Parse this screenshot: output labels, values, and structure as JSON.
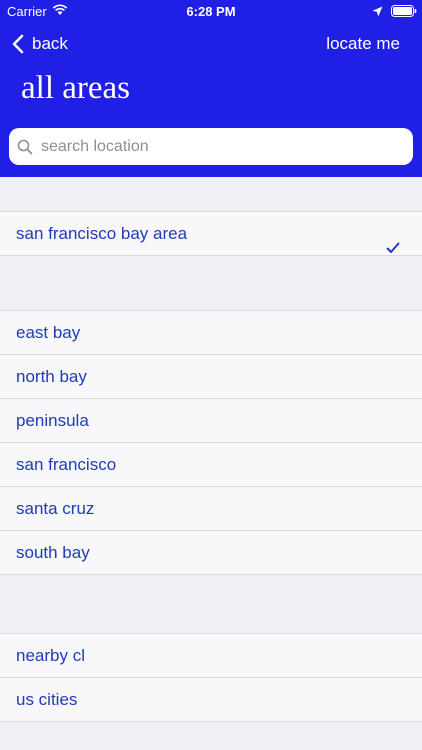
{
  "status_bar": {
    "carrier": "Carrier",
    "time": "6:28 PM",
    "icons": [
      "wifi-icon",
      "location-arrow-icon",
      "battery-icon"
    ]
  },
  "nav": {
    "back_label": "back",
    "locate_label": "locate me"
  },
  "title": "all areas",
  "search": {
    "placeholder": "search location"
  },
  "sections": [
    {
      "items": [
        {
          "label": "san francisco bay area",
          "selected": true
        }
      ]
    },
    {
      "items": [
        {
          "label": "east bay"
        },
        {
          "label": "north bay"
        },
        {
          "label": "peninsula"
        },
        {
          "label": "san francisco"
        },
        {
          "label": "santa cruz"
        },
        {
          "label": "south bay"
        }
      ]
    },
    {
      "items": [
        {
          "label": "nearby cl"
        },
        {
          "label": "us cities"
        }
      ]
    }
  ],
  "colors": {
    "header_bg": "#1f1fe6",
    "link_text": "#1f3bb8",
    "list_bg": "#f8f8fa",
    "page_bg": "#efeff4"
  }
}
